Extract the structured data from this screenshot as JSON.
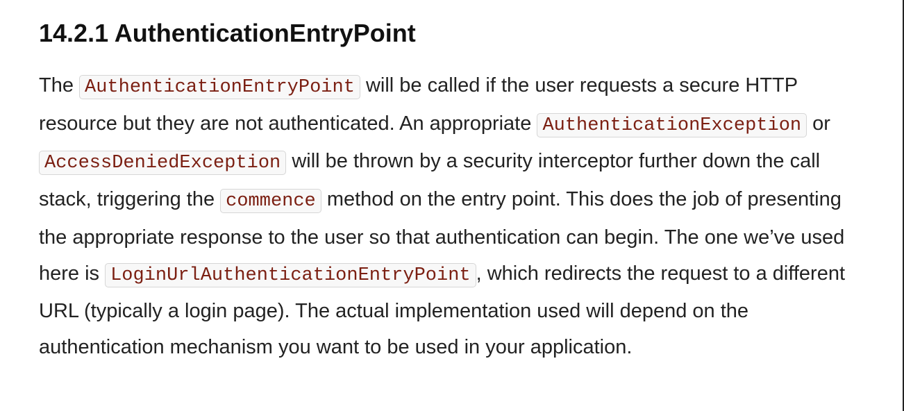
{
  "section": {
    "title": "14.2.1 AuthenticationEntryPoint",
    "paragraph": {
      "t1": "The ",
      "c1": "AuthenticationEntryPoint",
      "t2": " will be called if the user requests a secure HTTP resource but they are not authenticated. An appropriate ",
      "c2": "AuthenticationException",
      "t3": " or ",
      "c3": "AccessDeniedException",
      "t4": " will be thrown by a security interceptor further down the call stack, triggering the ",
      "c4": "commence",
      "t5": " method on the entry point. This does the job of presenting the appropriate response to the user so that authentication can begin. The one we’ve used here is ",
      "c5": "LoginUrlAuthenticationEntryPoint",
      "t6": ", which redirects the request to a different URL (typically a login page). The actual implementation used will depend on the authentication mechanism you want to be used in your application."
    }
  }
}
